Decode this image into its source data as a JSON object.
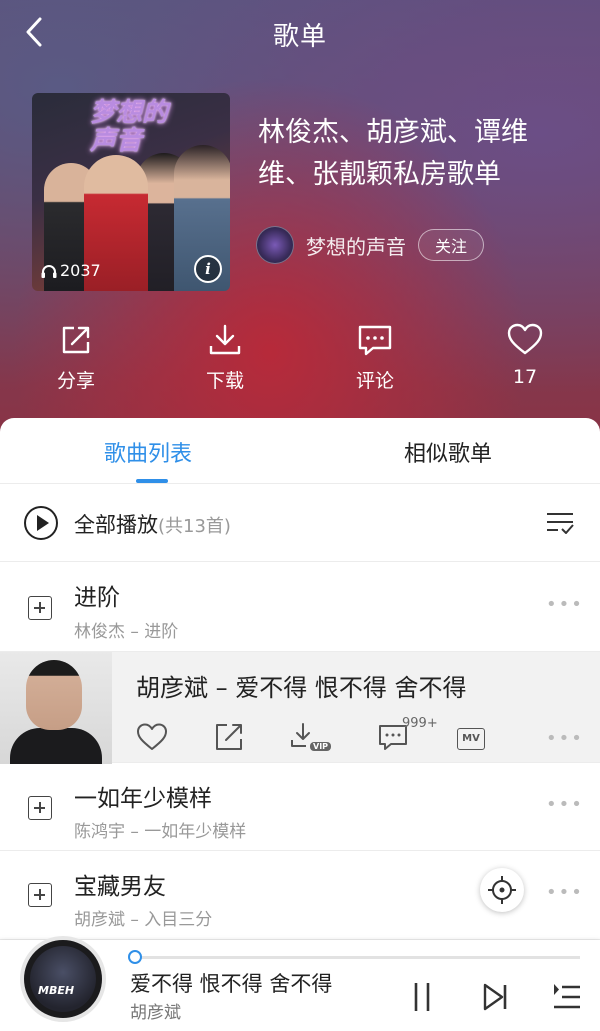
{
  "header": {
    "title": "歌单",
    "playlist_title": "林俊杰、胡彦斌、谭维维、张靓颖私房歌单",
    "play_count": "2037",
    "creator_name": "梦想的声音",
    "follow_label": "关注",
    "cover_logo": "梦想的声音"
  },
  "actions": [
    {
      "label": "分享",
      "icon": "share-icon"
    },
    {
      "label": "下载",
      "icon": "download-icon"
    },
    {
      "label": "评论",
      "icon": "comment-icon"
    },
    {
      "label": "17",
      "icon": "heart-icon"
    }
  ],
  "tabs": [
    {
      "label": "歌曲列表",
      "active": true
    },
    {
      "label": "相似歌单",
      "active": false
    }
  ],
  "play_all": {
    "label": "全部播放",
    "count": "(共13首)"
  },
  "songs": [
    {
      "title": "进阶",
      "subtitle": "林俊杰 – 进阶"
    },
    {
      "title": "胡彦斌 – 爱不得 恨不得 舍不得",
      "expanded": true,
      "comment_count": "999+",
      "vip_tag": "VIP",
      "mv_tag": "MV"
    },
    {
      "title": "一如年少模样",
      "subtitle": "陈鸿宇 – 一如年少模样"
    },
    {
      "title": "宝藏男友",
      "subtitle": "胡彦斌 – 入目三分"
    }
  ],
  "player": {
    "title": "爱不得 恨不得 舍不得",
    "artist": "胡彦斌",
    "progress": 0.0,
    "art_text": "MBEH"
  },
  "colors": {
    "accent": "#2f8fe8",
    "header_top": "#5d4f79",
    "header_bottom": "#8a3345"
  }
}
